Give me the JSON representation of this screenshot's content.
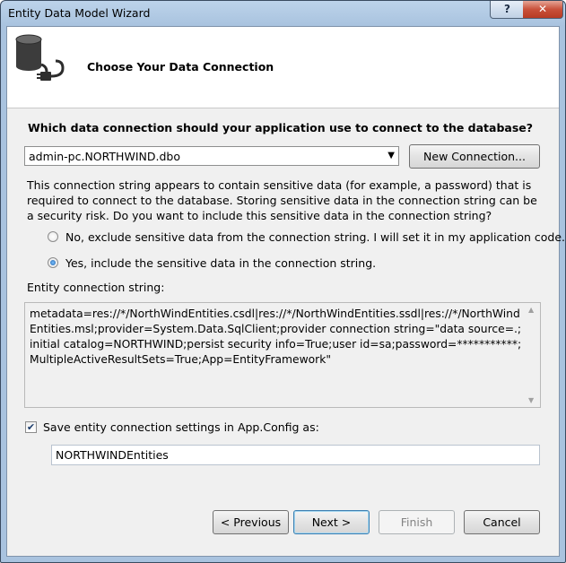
{
  "window": {
    "title": "Entity Data Model Wizard",
    "help_label": "?",
    "close_label": "✕"
  },
  "header": {
    "title": "Choose Your Data Connection"
  },
  "connection": {
    "question": "Which data connection should your application use to connect to the database?",
    "selected": "admin-pc.NORTHWIND.dbo",
    "new_connection_label": "New Connection..."
  },
  "sensitive": {
    "warning": "This connection string appears to contain sensitive data (for example, a password) that is required to connect to the database. Storing sensitive data in the connection string can be a security risk. Do you want to include this sensitive data in the connection string?",
    "option_no": "No, exclude sensitive data from the connection string. I will set it in my application code.",
    "option_yes": "Yes, include the sensitive data in the connection string.",
    "selected_option": "yes"
  },
  "entity_connection": {
    "label": "Entity connection string:",
    "value": "metadata=res://*/NorthWindEntities.csdl|res://*/NorthWindEntities.ssdl|res://*/NorthWindEntities.msl;provider=System.Data.SqlClient;provider connection string=\"data source=.;initial catalog=NORTHWIND;persist security info=True;user id=sa;password=***********;MultipleActiveResultSets=True;App=EntityFramework\""
  },
  "save": {
    "checked": true,
    "label": "Save entity connection settings in App.Config as:",
    "name": "NORTHWINDEntities"
  },
  "footer": {
    "previous_label": "< Previous",
    "next_label": "Next >",
    "finish_label": "Finish",
    "cancel_label": "Cancel"
  }
}
